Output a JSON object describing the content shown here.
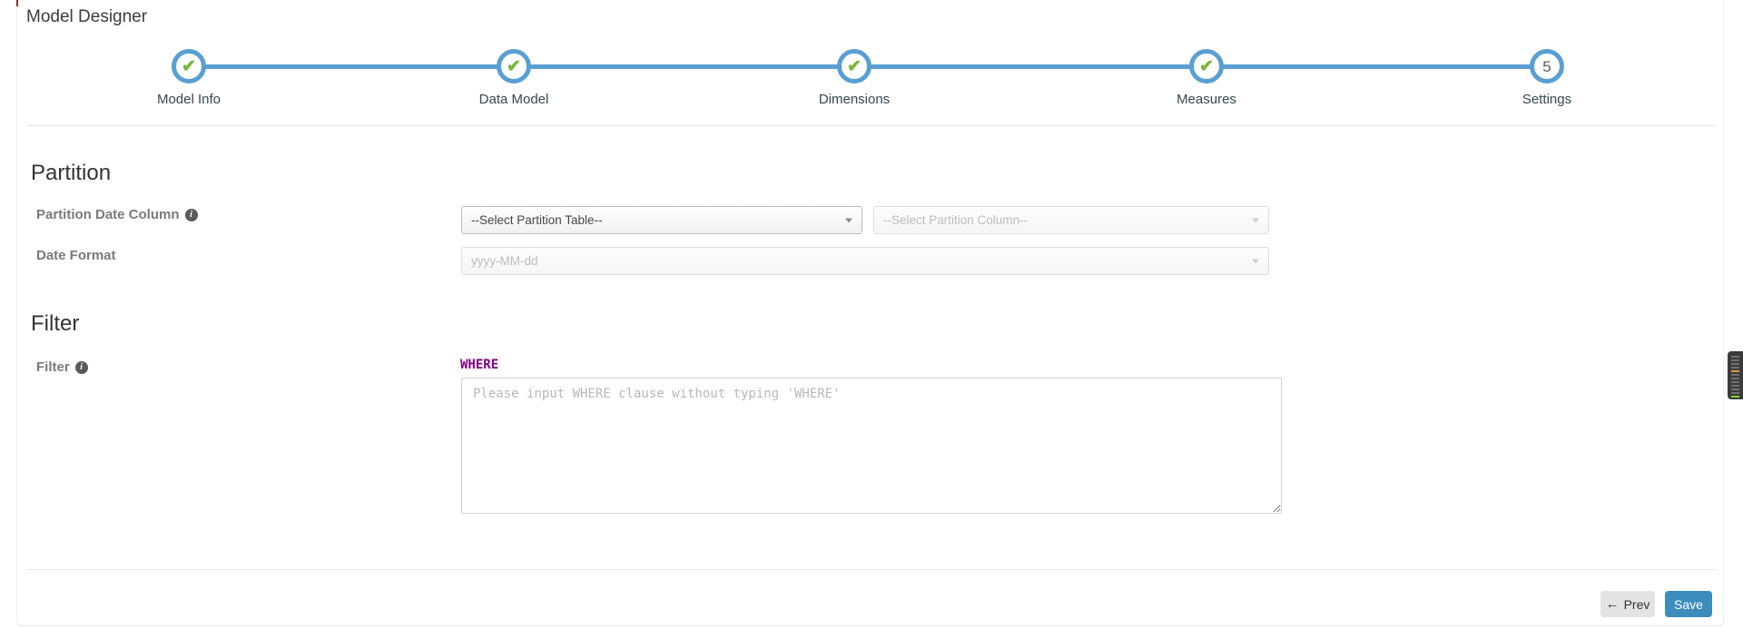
{
  "page": {
    "title": "Model Designer"
  },
  "stepper": {
    "steps": [
      {
        "label": "Model Info",
        "state": "done"
      },
      {
        "label": "Data Model",
        "state": "done"
      },
      {
        "label": "Dimensions",
        "state": "done"
      },
      {
        "label": "Measures",
        "state": "done"
      },
      {
        "label": "Settings",
        "state": "current",
        "number": "5"
      }
    ]
  },
  "partition": {
    "heading": "Partition",
    "date_column_label": "Partition Date Column",
    "table_select_value": "--Select Partition Table--",
    "column_select_value": "--Select Partition Column--",
    "date_format_label": "Date Format",
    "date_format_value": "yyyy-MM-dd"
  },
  "filter": {
    "heading": "Filter",
    "label": "Filter",
    "where_label": "WHERE",
    "placeholder": "Please input WHERE clause without typing 'WHERE'"
  },
  "footer": {
    "prev_label": "Prev",
    "save_label": "Save"
  },
  "icons": {
    "check": "✔",
    "info": "i",
    "prev_arrow": "←"
  },
  "colors": {
    "accent_blue": "#5a9fd4",
    "check_green": "#76b83a",
    "save_blue": "#3c8dbc",
    "where_purple": "#800080",
    "minimap_orange": "#e09a3e",
    "minimap_green": "#7ed321"
  }
}
